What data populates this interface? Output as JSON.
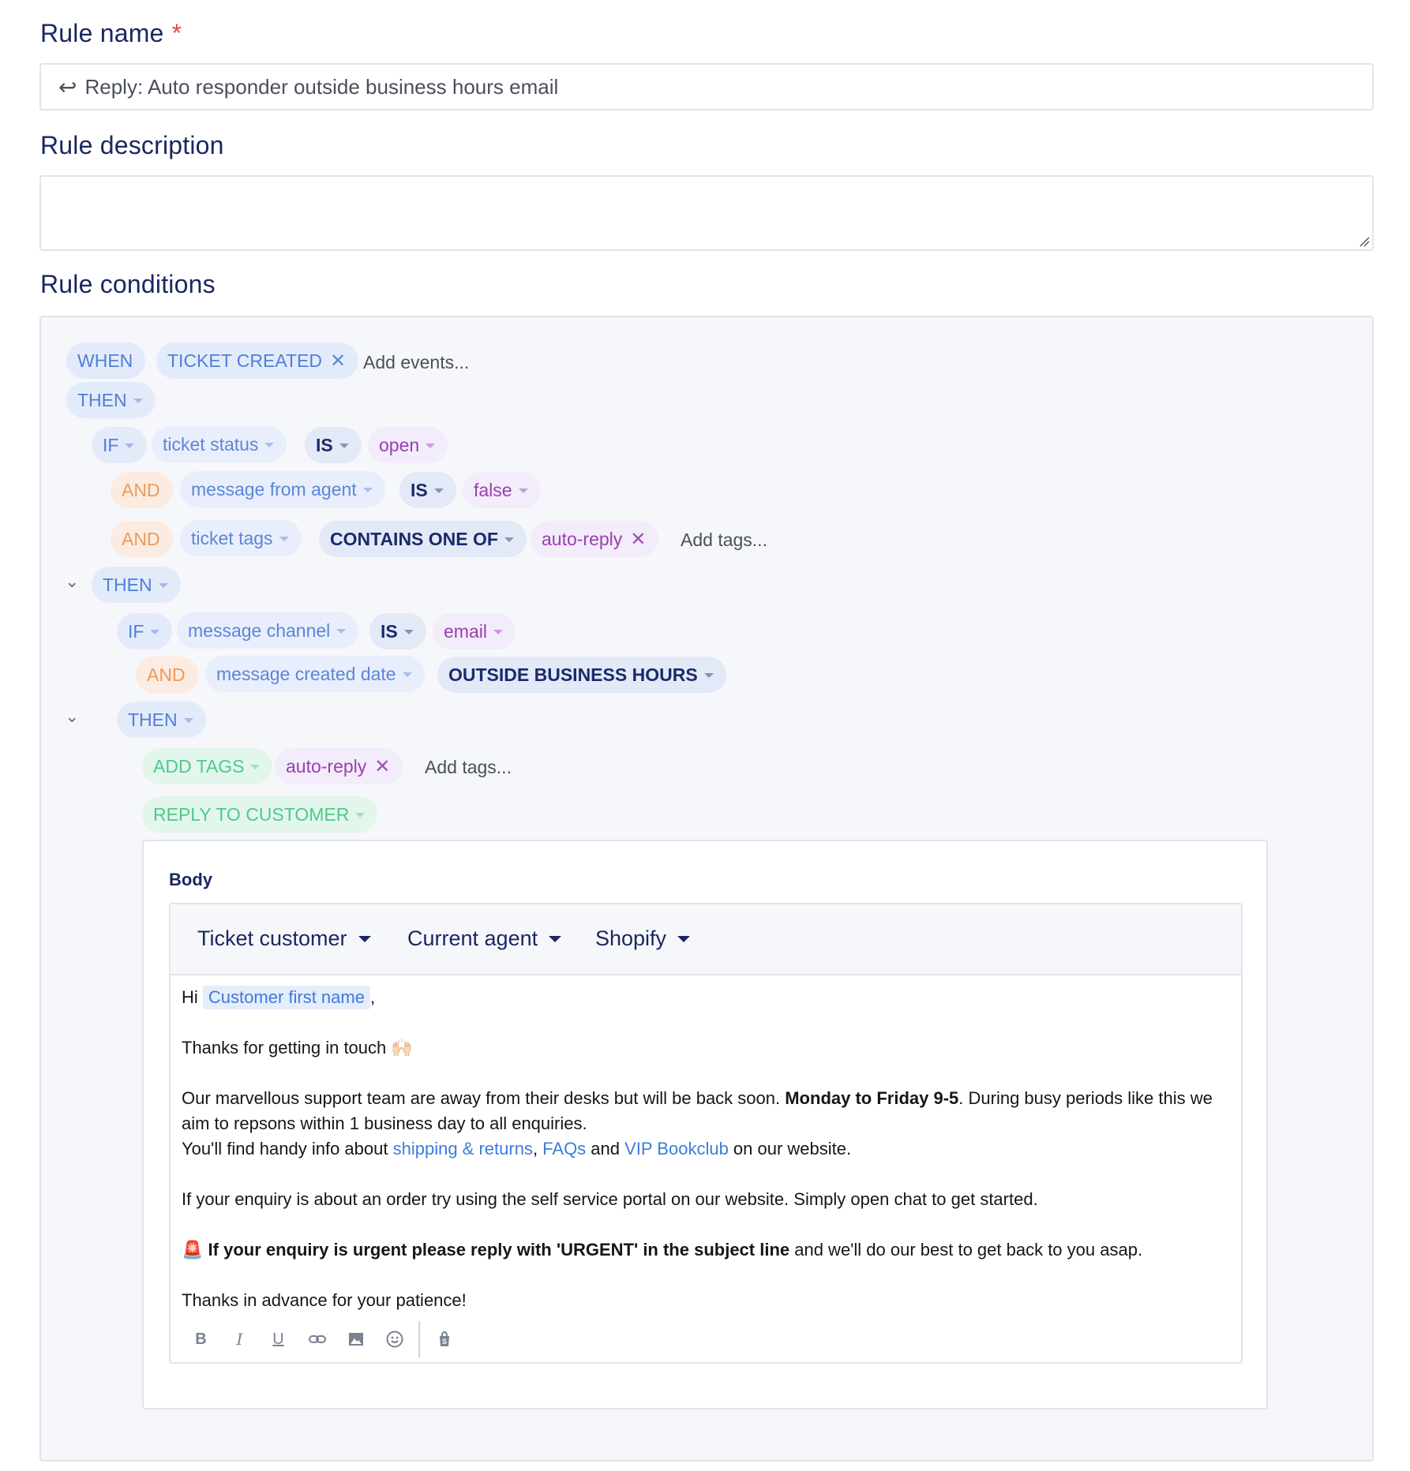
{
  "rule_name": {
    "label": "Rule name",
    "required_mark": "*",
    "value": "Reply: Auto responder outside business hours email"
  },
  "rule_description": {
    "label": "Rule description",
    "value": ""
  },
  "rule_conditions": {
    "label": "Rule conditions",
    "when": {
      "keyword": "WHEN",
      "event": "TICKET CREATED",
      "add_events_placeholder": "Add events..."
    },
    "then1": {
      "keyword": "THEN"
    },
    "if1": {
      "keyword": "IF",
      "field": "ticket status",
      "operator": "IS",
      "value": "open"
    },
    "and1": {
      "keyword": "AND",
      "field": "message from agent",
      "operator": "IS",
      "value": "false"
    },
    "and2": {
      "keyword": "AND",
      "field": "ticket tags",
      "operator": "CONTAINS ONE OF",
      "tag": "auto-reply",
      "add_tags_placeholder": "Add tags..."
    },
    "then2": {
      "keyword": "THEN"
    },
    "if2": {
      "keyword": "IF",
      "field": "message channel",
      "operator": "IS",
      "value": "email"
    },
    "and3": {
      "keyword": "AND",
      "field": "message created date",
      "operator": "OUTSIDE BUSINESS HOURS"
    },
    "then3": {
      "keyword": "THEN"
    },
    "action_add_tags": {
      "label": "ADD TAGS",
      "tag": "auto-reply",
      "add_tags_placeholder": "Add tags..."
    },
    "action_reply": {
      "label": "REPLY TO CUSTOMER"
    }
  },
  "reply_editor": {
    "body_label": "Body",
    "variable_menus": [
      "Ticket customer",
      "Current agent",
      "Shopify"
    ],
    "content": {
      "greeting_hi": "Hi",
      "customer_var": "Customer first name",
      "greeting_comma": ",",
      "thanks_line": "Thanks for getting in touch 🙌🏻",
      "away_text_1": "Our marvellous support team are away from their desks but will be back soon. ",
      "away_bold": "Monday to Friday 9-5",
      "away_text_2": ". During busy periods like this we aim to repsons within 1 business day to all enquiries.",
      "info_text_1": "You'll find handy info about ",
      "link_shipping": "shipping & returns",
      "info_comma": ", ",
      "link_faqs": "FAQs",
      "info_and": " and ",
      "link_vip": "VIP Bookclub",
      "info_text_2": " on our website.",
      "self_service_line": "If your enquiry is about an order try using the self service portal on our website. Simply open chat to get started.",
      "urgent_emoji": "🚨",
      "urgent_bold": "If your enquiry is urgent please reply with 'URGENT' in the subject line",
      "urgent_rest": " and we'll do our best to get back to you asap.",
      "closing": "Thanks in advance for your patience!"
    },
    "format_buttons": [
      "bold-icon",
      "italic-icon",
      "underline-icon",
      "link-icon",
      "image-icon",
      "emoji-icon",
      "shopify-icon"
    ]
  },
  "colors": {
    "heading": "#1a2761",
    "blue_pill": "#4f7fd6",
    "navy_pill": "#1b2a6b",
    "purple_pill": "#9a3fae",
    "orange_pill": "#ea9b5c",
    "green_pill": "#4fc98a",
    "required": "#e5484d",
    "link": "#3b7ddd"
  }
}
